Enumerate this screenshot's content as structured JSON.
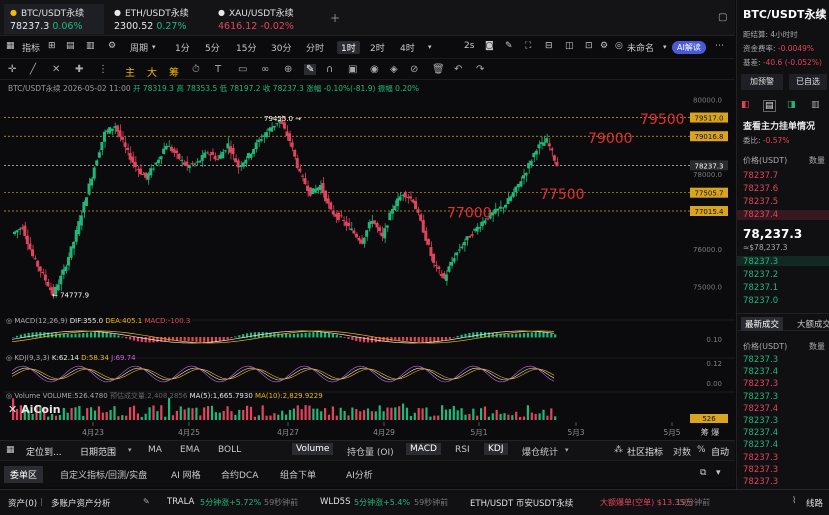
{
  "tabs": [
    {
      "name": "BTC/USDT永续",
      "price": "78237.3",
      "change": "0.06%",
      "dir": "up",
      "active": true
    },
    {
      "name": "ETH/USDT永续",
      "price": "2300.52",
      "change": "0.27%",
      "dir": "up",
      "active": false
    },
    {
      "name": "XAU/USDT永续",
      "price": "4616.12",
      "change": "-0.02%",
      "dir": "dn",
      "active": false
    }
  ],
  "add_tab": "+",
  "toolbar": {
    "indicators": "指标",
    "period": "周期",
    "intervals": [
      "1分",
      "5分",
      "15分",
      "30分",
      "分时",
      "1时",
      "2时",
      "4时"
    ],
    "active_interval": "1时",
    "refresh": "2s",
    "unnamed": "未命名",
    "ai": "AI解读"
  },
  "drawing_tools": {
    "main": "主",
    "big": "大",
    "chip": "筹",
    "clock": "⏱"
  },
  "chart": {
    "info_label": "BTC/USDT永续 2026-05-02 11:00",
    "open_label": "开 78319.3",
    "high_label": "高 78353.5",
    "low_label": "低 78197.2",
    "close_label": "收 78237.3",
    "change_label": "涨幅 -0.10%(-81.9)",
    "amp_label": "振幅 0.20%",
    "y_ticks": [
      "80000.0",
      "79000.0",
      "78000.0",
      "77000.0",
      "76000.0",
      "75000.0"
    ],
    "price_tags": [
      {
        "label": "79517.0",
        "price": 79517.0
      },
      {
        "label": "79016.8",
        "price": 79016.8
      },
      {
        "label": "78237.3",
        "price": 78237.3
      },
      {
        "label": "77505.7",
        "price": 77505.7
      },
      {
        "label": "77015.4",
        "price": 77015.4
      }
    ],
    "high_mark": "79455.0",
    "low_mark": "74777.9",
    "annotations": [
      {
        "text": "79500",
        "price": 79500
      },
      {
        "text": "79000",
        "price": 79000
      },
      {
        "text": "77000",
        "price": 77000
      },
      {
        "text": "77500",
        "price": 77500
      }
    ],
    "x_ticks": [
      "4月23",
      "4月25",
      "4月27",
      "4月29",
      "5月1",
      "5月3",
      "5月5"
    ],
    "macd_label": "MACD(12,26,9)",
    "macd_dif": "DIF:355.0",
    "macd_dea": "DEA:405.1",
    "macd_val": "MACD:-100.3",
    "macd_ticks": [
      "0.10",
      "0.0"
    ],
    "kdj_label": "KDJ(9,3,3)",
    "kdj_k": "K:62.14",
    "kdj_d": "D:58.34",
    "kdj_j": "J:69.74",
    "kdj_ticks": [
      "0.12",
      "0.00"
    ],
    "vol_label": "Volume",
    "vol_value": "VOLUME:526.4780",
    "vol_sub": "预估成交量:2,408.2856",
    "vol_ma5": "MA(5):1,665.7930",
    "vol_ma10": "MA(10):2,829.9229",
    "vol_tag": "526",
    "watermark": "AiCoin"
  },
  "chart_data": {
    "type": "candlestick",
    "info": "BTC/USDT永续 1时",
    "x": [
      "4月23",
      "4月25",
      "4月27",
      "4月29",
      "5月1",
      "5月3",
      "5月5"
    ],
    "ylim": [
      74500,
      80200
    ],
    "close_series": [
      76400,
      76600,
      75800,
      75300,
      74780,
      75400,
      76200,
      77200,
      78200,
      79100,
      79300,
      78700,
      78200,
      77900,
      78300,
      78800,
      78500,
      78200,
      78300,
      78600,
      78400,
      78800,
      78200,
      78500,
      78900,
      79200,
      79455,
      78900,
      78000,
      77500,
      77700,
      77000,
      76800,
      76500,
      76200,
      76800,
      76300,
      77100,
      77500,
      77300,
      76500,
      75600,
      75200,
      75800,
      76200,
      76500,
      76800,
      77000,
      77200,
      77600,
      78100,
      78700,
      78900,
      78237
    ]
  },
  "bottom_tools": {
    "draw_pos": "定位到...",
    "daily_range": "日期范围",
    "items": [
      "MA",
      "EMA",
      "BOLL",
      "Volume",
      "持仓量 (OI)",
      "MACD",
      "RSI",
      "KDJ",
      "爆仓统计"
    ],
    "active_items": [
      "Volume",
      "MACD",
      "KDJ"
    ],
    "community": "社区指标",
    "log": "对数",
    "pct": "%",
    "auto": "自动"
  },
  "bottom_tabs": [
    "委单区",
    "自定义指标/回测/实盘",
    "AI 网格",
    "合约DCA",
    "组合下单",
    "AI分析"
  ],
  "status": {
    "assets": "资产(0)",
    "multi": "多账户资产分析",
    "t1_name": "TRALA",
    "t1_info": "5分钟涨+5.72%",
    "t1_time": "59秒钟前",
    "t2_name": "WLD5S",
    "t2_info": "5分钟涨+5.4%",
    "t2_time": "59秒钟前",
    "t3_name": "ETH/USDT 币安USDT永续",
    "t3_info": "大额爆单(空单) $13.35万",
    "t3_time": "19分钟前",
    "link": "线路"
  },
  "right": {
    "title": "BTC/USDT永续",
    "countdown": "距结算: 4小时时",
    "funding_label": "资金费率:",
    "funding_val": "-0.0049%",
    "basis_label": "基差:",
    "basis_val": "-40.6 (-0.052%)",
    "prepay": "加预警",
    "added": "已自选",
    "orderbook_title": "查看主力挂单情况",
    "ratio_label": "委比:",
    "ratio_val": "-0.57%",
    "col_price": "价格(USDT)",
    "col_qty": "数量",
    "asks": [
      "78237.7",
      "78237.6",
      "78237.5",
      "78237.4"
    ],
    "last": "78,237.3",
    "last_sub": "≈$78,237.3",
    "bids": [
      "78237.3",
      "78237.2",
      "78237.1",
      "78237.0"
    ],
    "trades_tab": "最新成交",
    "big_tab": "大额成交",
    "trades": [
      "78237.3",
      "78237.4",
      "78237.3",
      "78237.3",
      "78237.4",
      "78237.3",
      "78237.4",
      "78237.4",
      "78237.3",
      "78237.3",
      "78237.3"
    ],
    "trades_dir": [
      "up",
      "up",
      "dn",
      "up",
      "dn",
      "up",
      "up",
      "up",
      "dn",
      "dn",
      "dn"
    ]
  }
}
